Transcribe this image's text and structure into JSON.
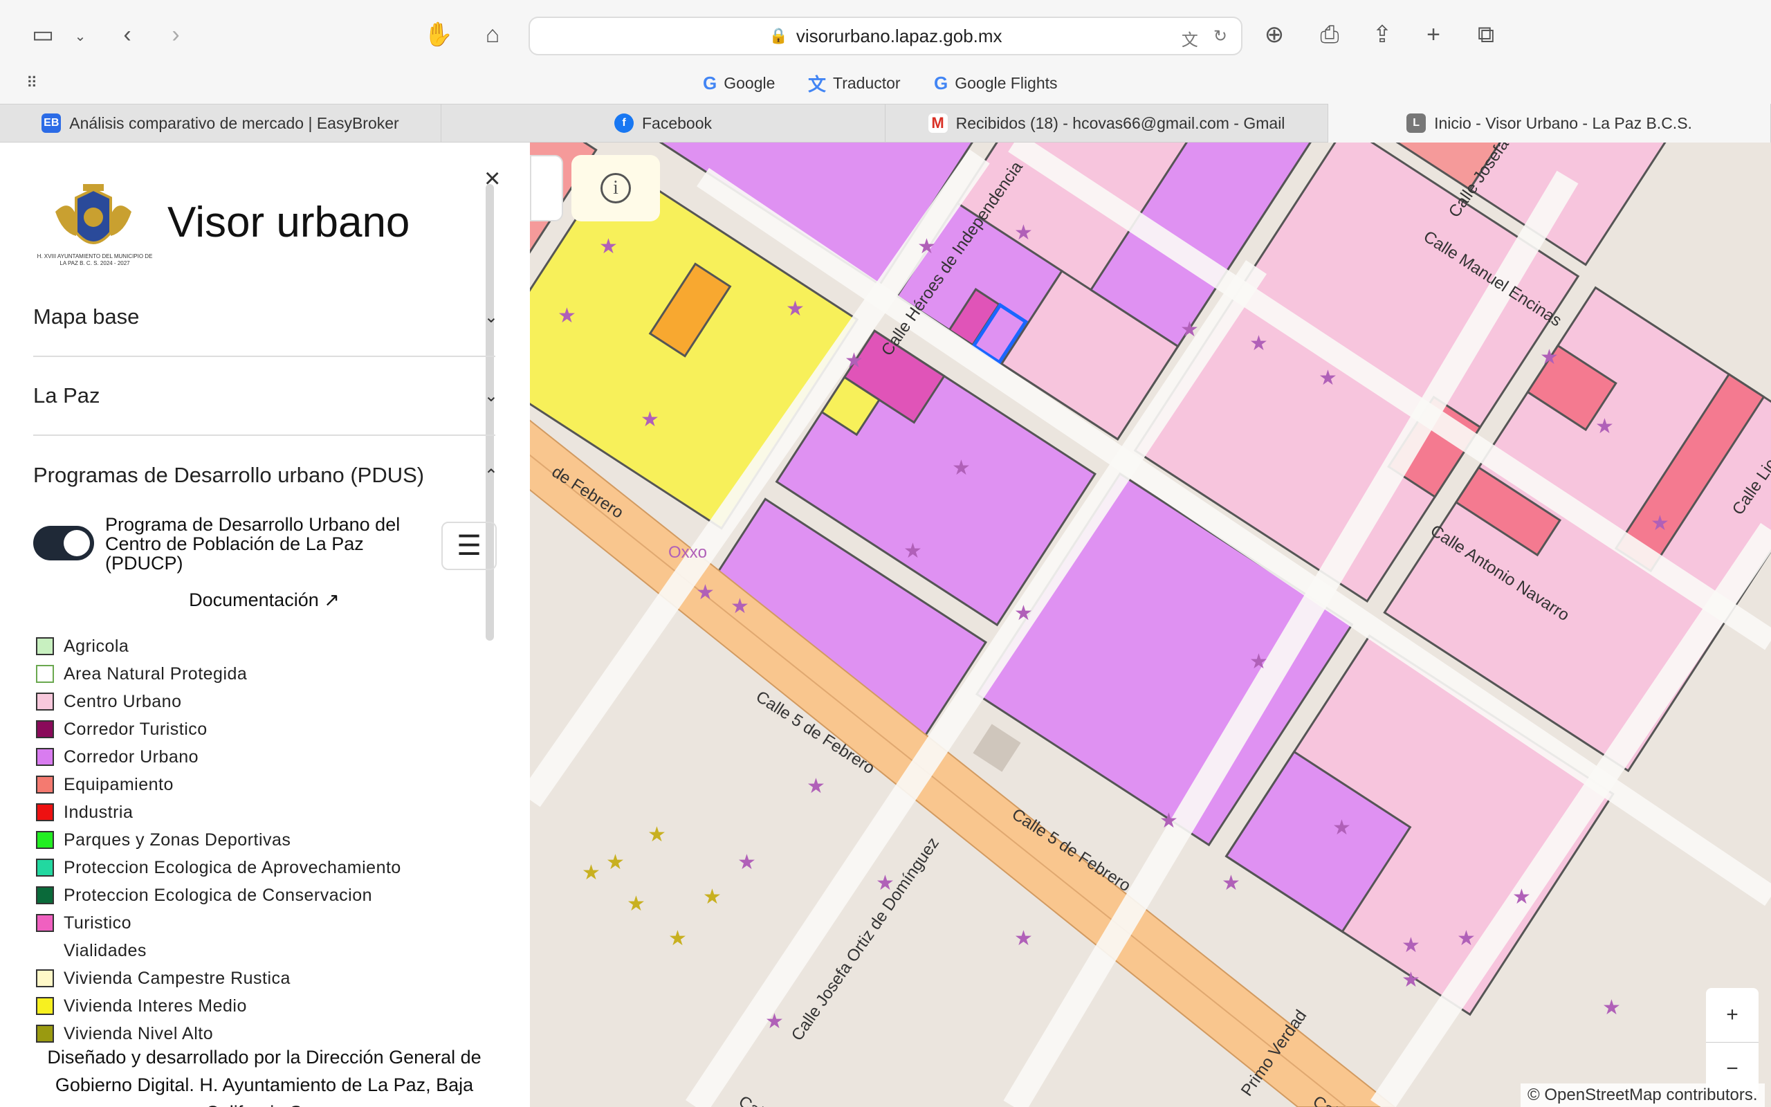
{
  "browser": {
    "url": "visorurbano.lapaz.gob.mx",
    "bookmarks": [
      {
        "label": "Google"
      },
      {
        "label": "Traductor"
      },
      {
        "label": "Google Flights"
      }
    ],
    "tabs": [
      {
        "label": "Análisis comparativo de mercado | EasyBroker",
        "favicon": "EB"
      },
      {
        "label": "Facebook",
        "favicon": "f"
      },
      {
        "label": "Recibidos (18) - hcovas66@gmail.com - Gmail",
        "favicon": "M"
      },
      {
        "label": "Inicio - Visor Urbano - La Paz B.C.S.",
        "favicon": "L"
      }
    ]
  },
  "sidebar": {
    "seal_text": "H. XVIII AYUNTAMIENTO DEL MUNICIPIO DE LA PAZ B. C. S. 2024 - 2027",
    "title": "Visor urbano",
    "sections": [
      {
        "label": "Mapa base",
        "chevron": "chevron-down"
      },
      {
        "label": "La Paz",
        "chevron": "chevron-down"
      },
      {
        "label": "Programas de Desarrollo urbano (PDUS)",
        "chevron": "chevron-up"
      }
    ],
    "program_label": "Programa de Desarrollo Urbano del Centro de Población de La Paz (PDUCP)",
    "program_enabled": true,
    "documentation_label": "Documentación",
    "legend": [
      {
        "label": "Agricola",
        "color": "#c8f0c0",
        "border": "#333"
      },
      {
        "label": "Area Natural Protegida",
        "color": "#ffffff",
        "border": "#6aa84f"
      },
      {
        "label": "Centro Urbano",
        "color": "#f8c8dc",
        "border": "#333"
      },
      {
        "label": "Corredor Turistico",
        "color": "#8a0a5a",
        "border": "#333"
      },
      {
        "label": "Corredor Urbano",
        "color": "#d97cf0",
        "border": "#333"
      },
      {
        "label": "Equipamiento",
        "color": "#f47a70",
        "border": "#333"
      },
      {
        "label": "Industria",
        "color": "#ee1111",
        "border": "#333"
      },
      {
        "label": "Parques y Zonas Deportivas",
        "color": "#22ee22",
        "border": "#333"
      },
      {
        "label": "Proteccion Ecologica de Aprovechamiento",
        "color": "#22d8a0",
        "border": "#333"
      },
      {
        "label": "Proteccion Ecologica de Conservacion",
        "color": "#0a6a3a",
        "border": "#333"
      },
      {
        "label": "Turistico",
        "color": "#f060c0",
        "border": "#333"
      },
      {
        "label": "Vialidades",
        "color": "transparent",
        "border": "transparent"
      },
      {
        "label": "Vivienda Campestre Rustica",
        "color": "#fff8c8",
        "border": "#333"
      },
      {
        "label": "Vivienda Interes Medio",
        "color": "#f7f020",
        "border": "#333"
      },
      {
        "label": "Vivienda Nivel Alto",
        "color": "#9a9a10",
        "border": "#333"
      }
    ],
    "footer": "Diseñado y desarrollado por la Dirección General de Gobierno Digital. H. Ayuntamiento de La Paz, Baja California Sur."
  },
  "map": {
    "street_labels": [
      "Calle Héroes de Independencia",
      "Calle Josefa",
      "Calle Manuel Encinas",
      "Calle Antonio Navarro",
      "Calle Licenciado",
      "de Febrero",
      "Calle 5 de Febrero",
      "Calle 5 de Febrero",
      "Calle Josefa Ortiz de Domínguez",
      "Primo Verdad",
      "Calle",
      "Calle"
    ],
    "poi_label": "Oxxo",
    "attribution": "© OpenStreetMap contributors.",
    "zoom_in": "+",
    "zoom_out": "−"
  }
}
